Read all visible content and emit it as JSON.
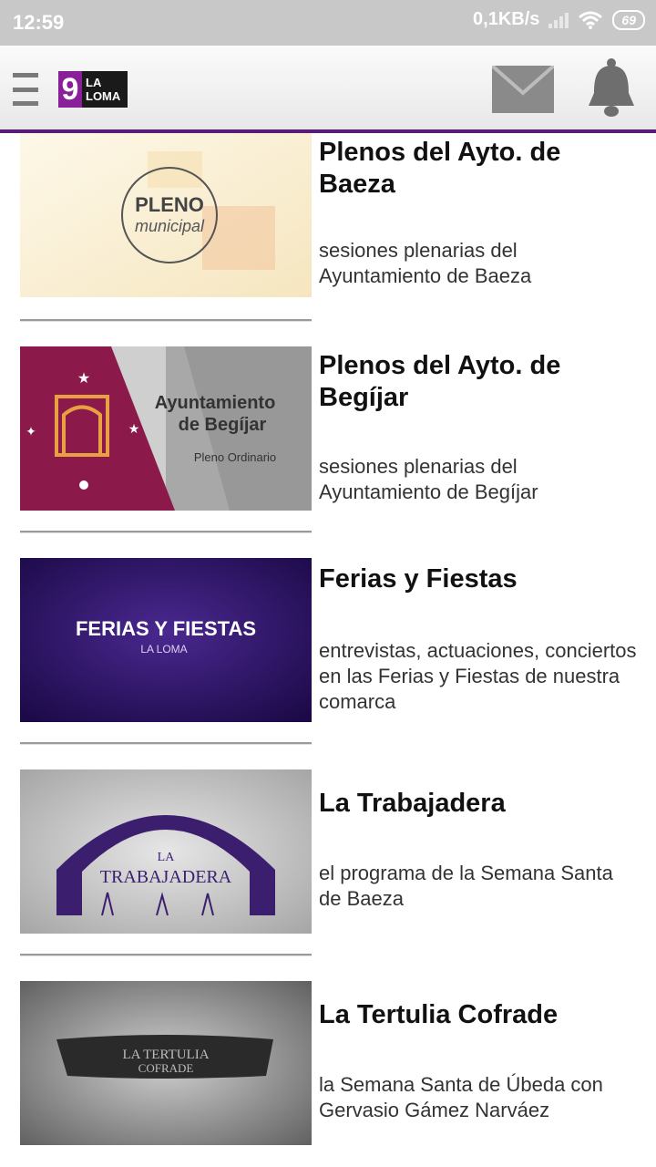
{
  "status": {
    "time": "12:59",
    "speed": "0,1KB/s",
    "battery": "69"
  },
  "header": {
    "logo_number": "9",
    "logo_line1": "LA",
    "logo_line2": "LOMA"
  },
  "items": [
    {
      "title": "Plenos del Ayto. de Baeza",
      "description": "sesiones plenarias del Ayuntamiento de Baeza",
      "thumb_word1": "PLENO",
      "thumb_word2": "municipal"
    },
    {
      "title": "Plenos del Ayto. de Begíjar",
      "description": "sesiones plenarias del Ayuntamiento de Begíjar",
      "thumb_word1": "Ayuntamiento",
      "thumb_word2": "de Begíjar",
      "thumb_word3": "Pleno Ordinario"
    },
    {
      "title": "Ferias y Fiestas",
      "description": "entrevistas, actuaciones, conciertos en las Ferias y Fiestas de nuestra comarca",
      "thumb_word1": "FERIAS Y FIESTAS",
      "thumb_word2": "LA LOMA"
    },
    {
      "title": "La Trabajadera",
      "description": "el programa de la Semana Santa de Baeza",
      "thumb_word1": "LA",
      "thumb_word2": "TRABAJADERA"
    },
    {
      "title": "La Tertulia Cofrade",
      "description": "la Semana Santa de Úbeda con Gervasio Gámez Narváez",
      "thumb_word1": "LA TERTULIA",
      "thumb_word2": "COFRADE"
    }
  ],
  "colors": {
    "accent": "#5a1a78",
    "logo_purple": "#8a1f9a",
    "status_bar": "#c8c8c8"
  },
  "icons": [
    "menu-icon",
    "mail-icon",
    "bell-icon",
    "signal-icon",
    "wifi-icon",
    "battery-icon"
  ]
}
